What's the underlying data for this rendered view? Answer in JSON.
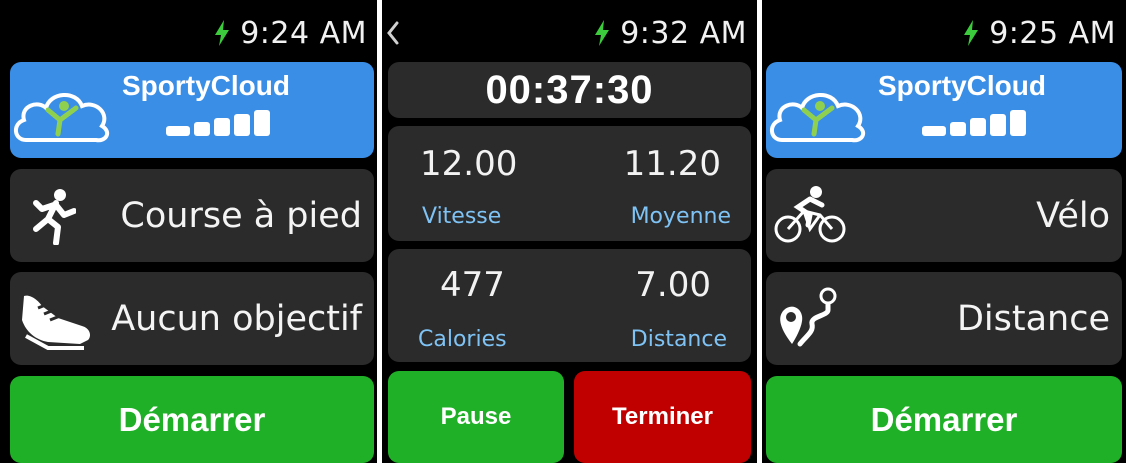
{
  "screens": [
    {
      "time": "9:24 AM",
      "brand": "SportyCloud",
      "activity": "Course à pied",
      "goal": "Aucun objectif",
      "start_label": "Démarrer"
    },
    {
      "time": "9:32 AM",
      "elapsed": "00:37:30",
      "metrics": {
        "speed": {
          "value": "12.00",
          "label": "Vitesse"
        },
        "average": {
          "value": "11.20",
          "label": "Moyenne"
        },
        "calories": {
          "value": "477",
          "label": "Calories"
        },
        "distance": {
          "value": "7.00",
          "label": "Distance"
        }
      },
      "pause_label": "Pause",
      "end_label": "Terminer"
    },
    {
      "time": "9:25 AM",
      "brand": "SportyCloud",
      "activity": "Vélo",
      "goal": "Distance",
      "start_label": "Démarrer"
    }
  ],
  "colors": {
    "brand_blue": "#3a8ee6",
    "start_green": "#20b027",
    "stop_red": "#c00000",
    "charging_bolt": "#3ccb3c",
    "metric_label": "#7fc3f5",
    "card_gray": "#2b2b2b"
  },
  "icons": {
    "status": "charging-bolt-icon",
    "brand": "cloud-runner-logo",
    "running": "runner-icon",
    "goal_none": "running-shoe-icon",
    "cycling": "cyclist-icon",
    "goal_distance": "route-pin-icon",
    "back": "chevron-left-icon"
  }
}
